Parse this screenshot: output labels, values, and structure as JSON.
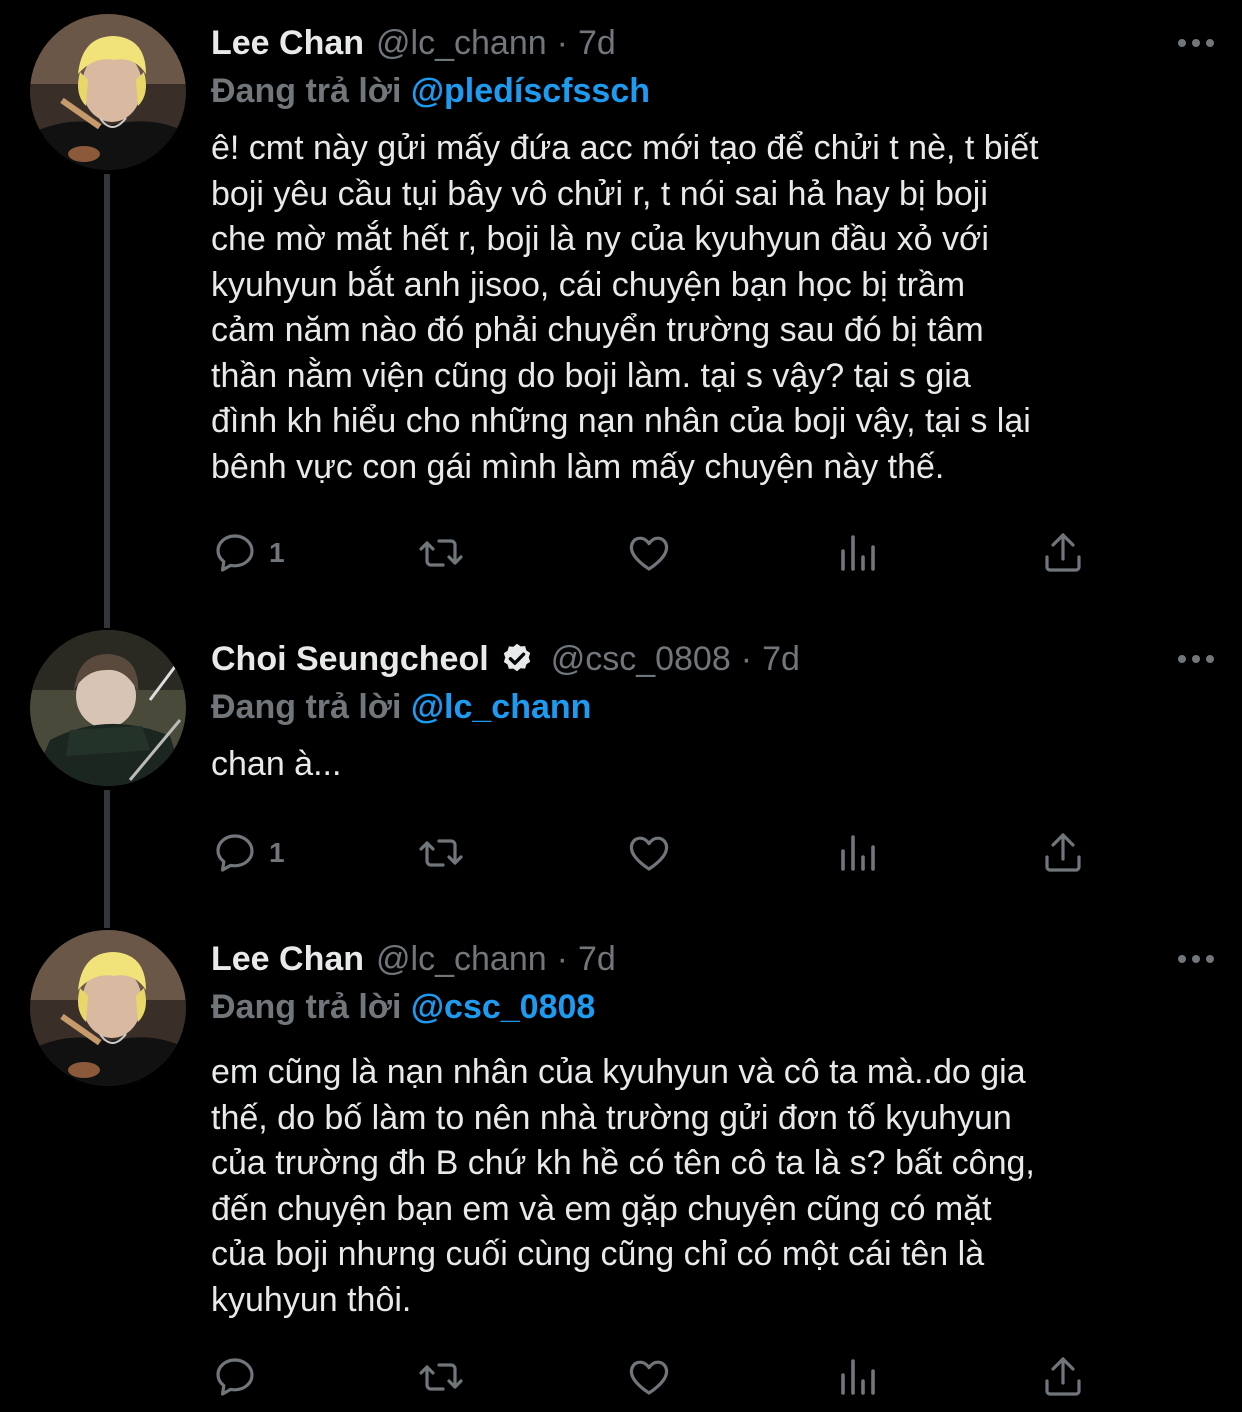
{
  "colors": {
    "background": "#000000",
    "text": "#e7e9ea",
    "muted": "#71767b",
    "link": "#1d9bf0",
    "thread_line": "#333639"
  },
  "reply_prefix": "Đang trả lời",
  "tweets": [
    {
      "name": "Lee Chan",
      "handle": "@lc_chann",
      "separator": "·",
      "time": "7d",
      "verified": false,
      "reply_to": "@pledíscfssch",
      "text": "ê! cmt này gửi mấy đứa acc mới tạo để chửi t nè, t biết\nboji yêu cầu tụi bây vô chửi r, t nói sai hả hay bị boji\nche mờ mắt hết r, boji là ny của kyuhyun đầu xỏ với\nkyuhyun bắt anh jisoo, cái chuyện bạn học bị trầm\ncảm năm nào đó phải chuyển trường sau đó bị tâm\nthần nằm viện cũng do boji làm. tại s vậy? tại s gia\nđình kh hiểu cho những nạn nhân của boji vậy, tại s lại\nbênh vực con gái mình làm mấy chuyện này thế.",
      "reply_count": "1",
      "avatar_icon": "person-blond-hair-avatar"
    },
    {
      "name": "Choi Seungcheol",
      "handle": "@csc_0808",
      "separator": "·",
      "time": "7d",
      "verified": true,
      "reply_to": "@lc_chann",
      "text": "chan à...",
      "reply_count": "1",
      "avatar_icon": "person-dark-hair-avatar"
    },
    {
      "name": "Lee Chan",
      "handle": "@lc_chann",
      "separator": "·",
      "time": "7d",
      "verified": false,
      "reply_to": "@csc_0808",
      "text": "em cũng là nạn nhân của kyuhyun và cô ta mà..do gia\nthế, do bố làm to nên nhà trường gửi đơn tố kyuhyun\ncủa trường đh B chứ kh hề có tên cô ta là s? bất công,\nđến chuyện bạn em và em gặp chuyện cũng có mặt\ncủa boji nhưng cuối cùng cũng chỉ có một cái tên là\nkyuhyun thôi.",
      "reply_count": "",
      "avatar_icon": "person-blond-hair-avatar"
    }
  ]
}
